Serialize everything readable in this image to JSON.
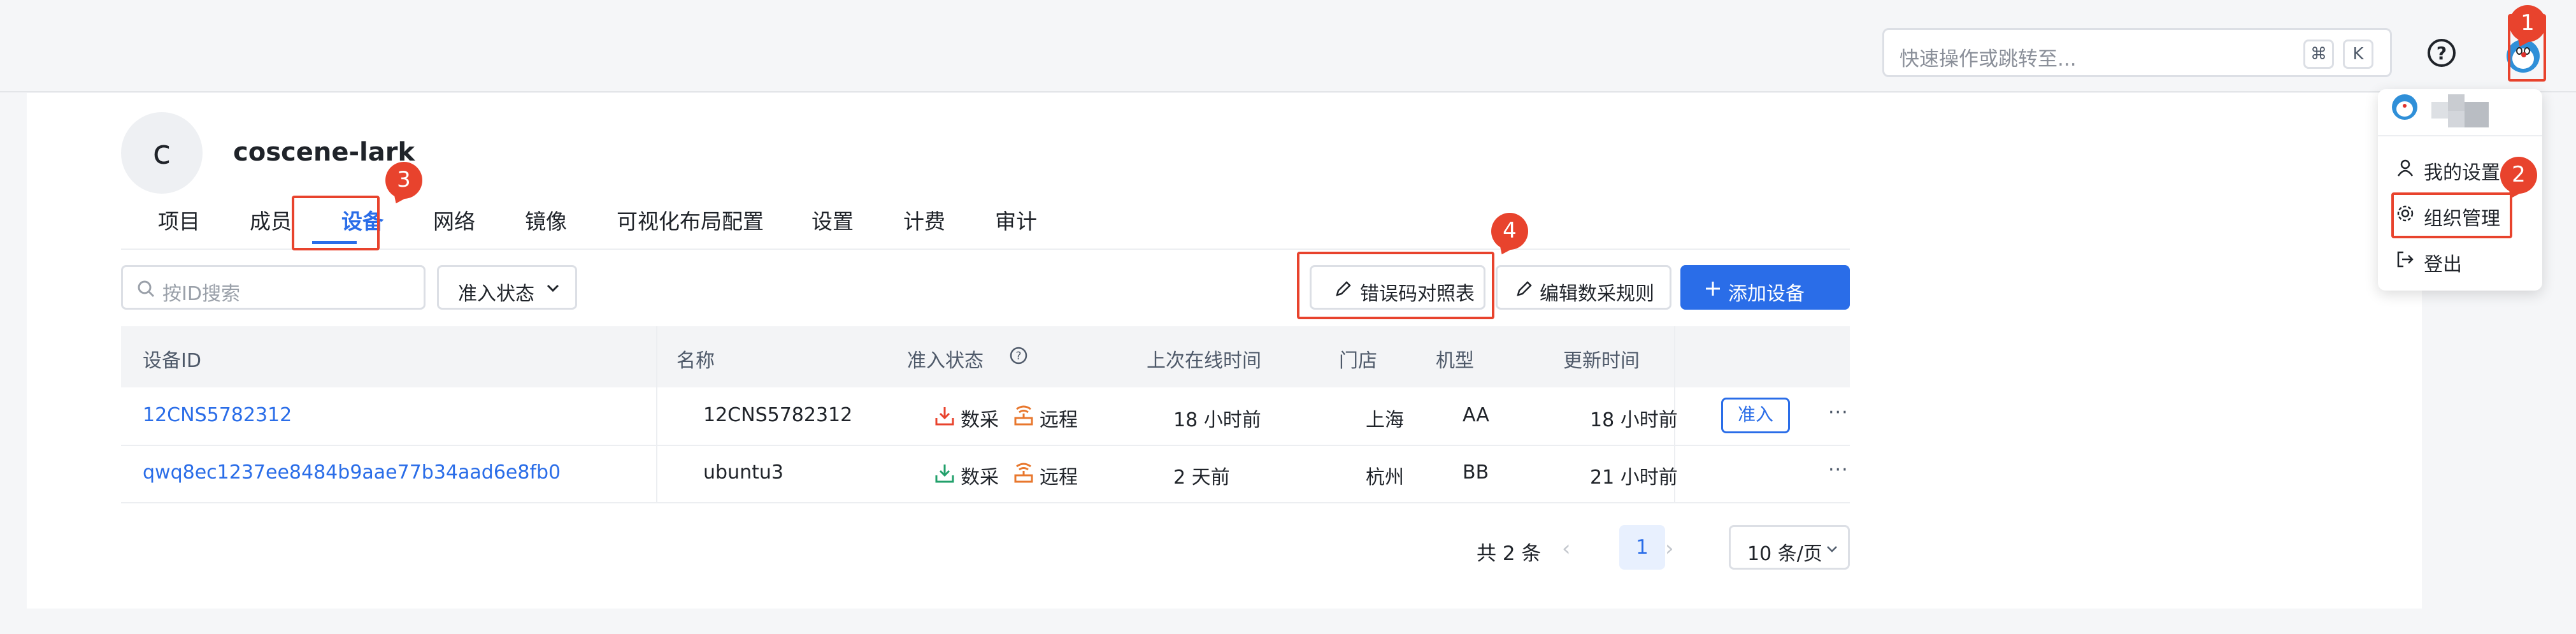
{
  "header": {
    "search_placeholder": "快速操作或跳转至...",
    "shortcut_cmd": "⌘",
    "shortcut_k": "K",
    "help_icon": "question-circle-icon",
    "user_avatar_icon": "doraemon-avatar-icon"
  },
  "org": {
    "avatar_letter": "c",
    "name": "coscene-lark"
  },
  "tabs": [
    "项目",
    "成员",
    "设备",
    "网络",
    "镜像",
    "可视化布局配置",
    "设置",
    "计费",
    "审计"
  ],
  "active_tab": "设备",
  "toolbar": {
    "search_placeholder": "按ID搜索",
    "status_filter": "准入状态",
    "error_code_button": "错误码对照表",
    "edit_rules_button": "编辑数采规则",
    "add_device_button": "添加设备"
  },
  "table": {
    "columns": [
      "设备ID",
      "名称",
      "准入状态",
      "上次在线时间",
      "门店",
      "机型",
      "更新时间"
    ],
    "rows": [
      {
        "id": "12CNS5782312",
        "name": "12CNS5782312",
        "data_label": "数采",
        "remote_label": "远程",
        "last_online": "18 小时前",
        "store": "上海",
        "model": "AA",
        "updated": "18 小时前",
        "action": "准入",
        "more": "···",
        "data_color": "#e8432d"
      },
      {
        "id": "qwq8ec1237ee8484b9aae77b34aad6e8fb0",
        "name": "ubuntu3",
        "data_label": "数采",
        "remote_label": "远程",
        "last_online": "2 天前",
        "store": "杭州",
        "model": "BB",
        "updated": "21 小时前",
        "action": "",
        "more": "···",
        "data_color": "#22a06b"
      }
    ]
  },
  "pagination": {
    "total": "共 2 条",
    "prev": "‹",
    "current_page": "1",
    "next": "›",
    "page_size": "10 条/页"
  },
  "user_menu": {
    "items": [
      "我的设置",
      "组织管理",
      "登出"
    ]
  },
  "annotations": [
    "1",
    "2",
    "3",
    "4"
  ],
  "colors": {
    "accent": "#2a6de8",
    "highlight": "#e8432d",
    "remote": "#e8772d"
  }
}
